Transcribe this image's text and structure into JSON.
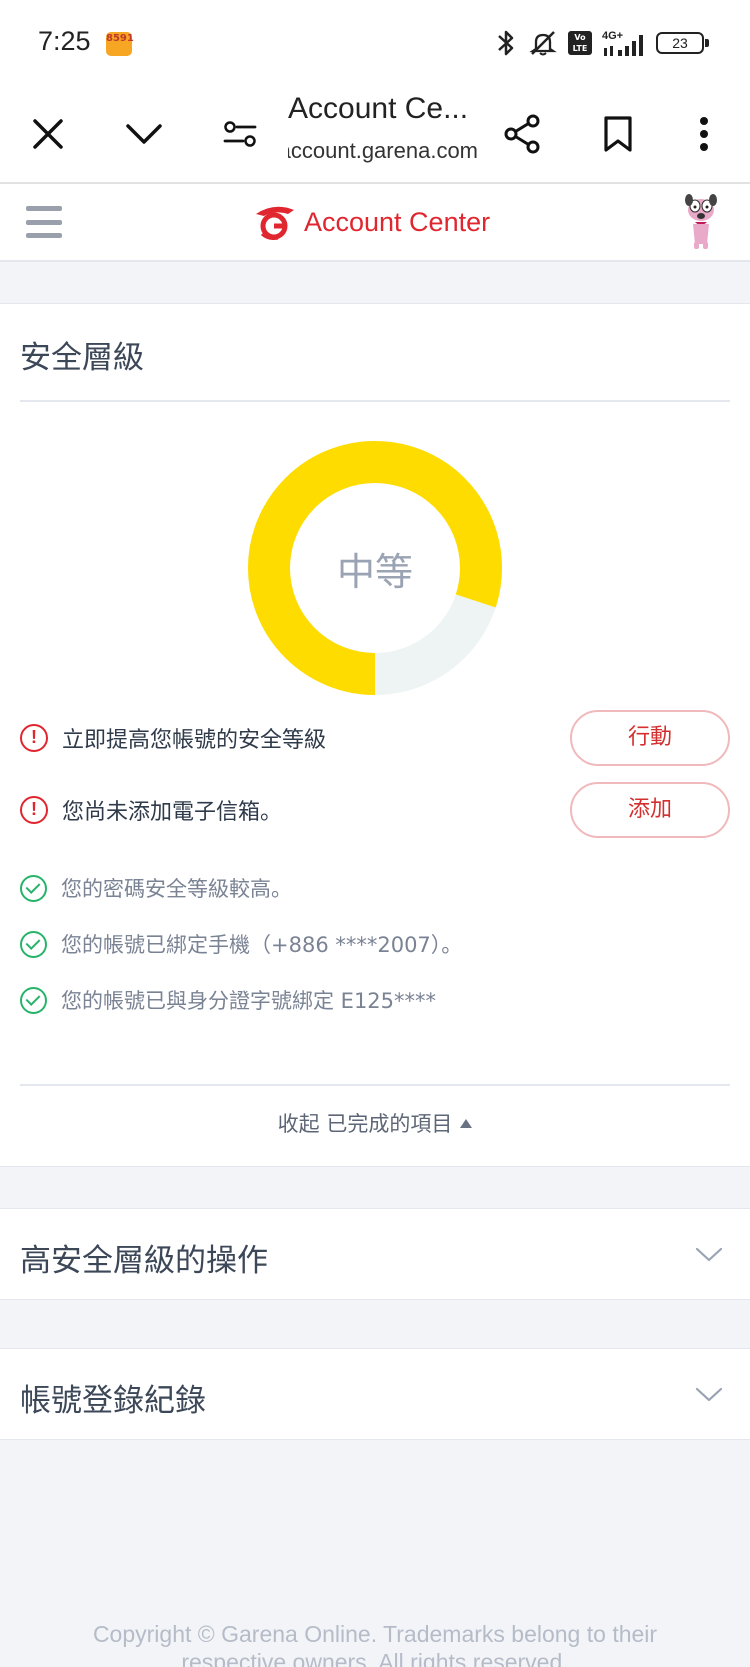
{
  "status_bar": {
    "time": "7:25",
    "app_badge": "8591",
    "network": "4G+",
    "volte": "Vo LTE",
    "battery": "23"
  },
  "browser": {
    "tab_title": "Account Ce...",
    "url": "account.garena.com",
    "icons": [
      "close-icon",
      "chevron-down-icon",
      "site-settings-icon",
      "share-icon",
      "bookmark-icon",
      "more-icon"
    ]
  },
  "header": {
    "brand": "Account Center",
    "brand_color": "#e0262f"
  },
  "security": {
    "title": "安全層級",
    "level_label": "中等",
    "level_fraction": 0.8,
    "ring_color": "#ffdc00",
    "ring_rest_color": "#eef4f3",
    "alerts": [
      {
        "text": "立即提高您帳號的安全等級",
        "button": "行動"
      },
      {
        "text": "您尚未添加電子信箱。",
        "button": "添加"
      }
    ],
    "completed": [
      {
        "text": "您的密碼安全等級較高。"
      },
      {
        "text": "您的帳號已綁定手機（+886 ****2007）。"
      },
      {
        "text": "您的帳號已與身分證字號綁定 E125****"
      }
    ],
    "collapse_label": "收起 已完成的項目"
  },
  "sections": [
    {
      "title": "高安全層級的操作"
    },
    {
      "title": "帳號登錄紀錄"
    }
  ],
  "footer": {
    "line1": "Copyright © Garena Online. Trademarks belong to their",
    "line2": "respective owners. All rights reserved."
  }
}
